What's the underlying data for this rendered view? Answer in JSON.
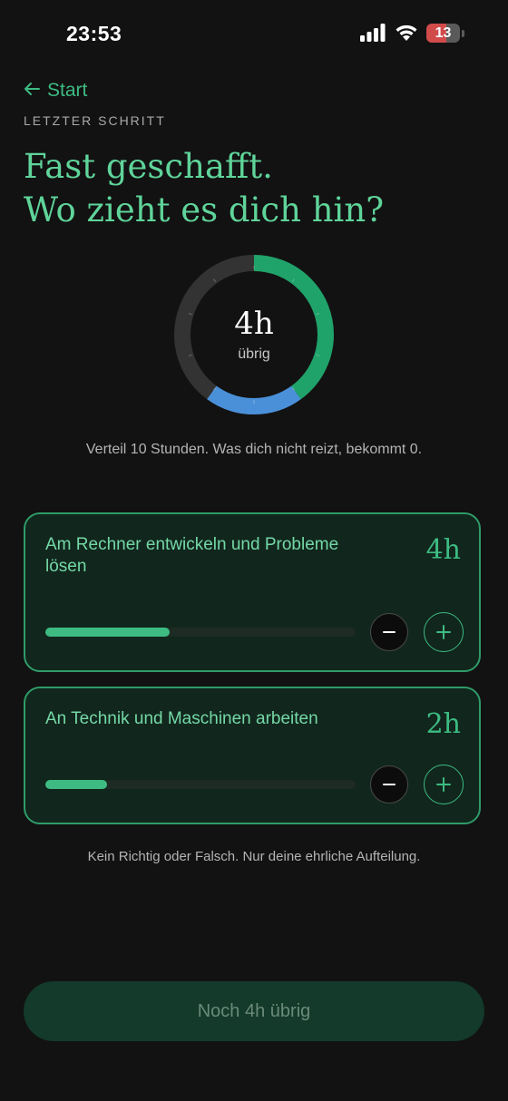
{
  "status_bar": {
    "time": "23:53",
    "battery_level": "13"
  },
  "nav": {
    "back_label": "Start"
  },
  "step_label": "LETZTER SCHRITT",
  "headline": {
    "line1": "Fast geschafft.",
    "line2": "Wo zieht es dich hin?"
  },
  "summary": {
    "remaining_value": "4h",
    "remaining_label": "übrig",
    "total_hours": 10,
    "segments": [
      {
        "name": "Am Rechner entwickeln und Probleme lösen",
        "hours": 4,
        "color": "#1fa36a"
      },
      {
        "name": "An Technik und Maschinen arbeiten",
        "hours": 2,
        "color": "#4a90d9"
      }
    ],
    "remaining_color": "#333333"
  },
  "hint": "Verteil 10 Stunden. Was dich nicht reizt, bekommt 0.",
  "cards": [
    {
      "title": "Am Rechner entwickeln und Probleme lösen",
      "hours_label": "4h",
      "fraction": 0.4
    },
    {
      "title": "An Technik und Maschinen arbeiten",
      "hours_label": "2h",
      "fraction": 0.2
    }
  ],
  "footer_note": "Kein Richtig oder Falsch. Nur deine ehrliche Aufteilung.",
  "cta_label": "Noch 4h übrig",
  "colors": {
    "accent": "#3dbb82",
    "background": "#121212",
    "card_background": "#11261d"
  }
}
